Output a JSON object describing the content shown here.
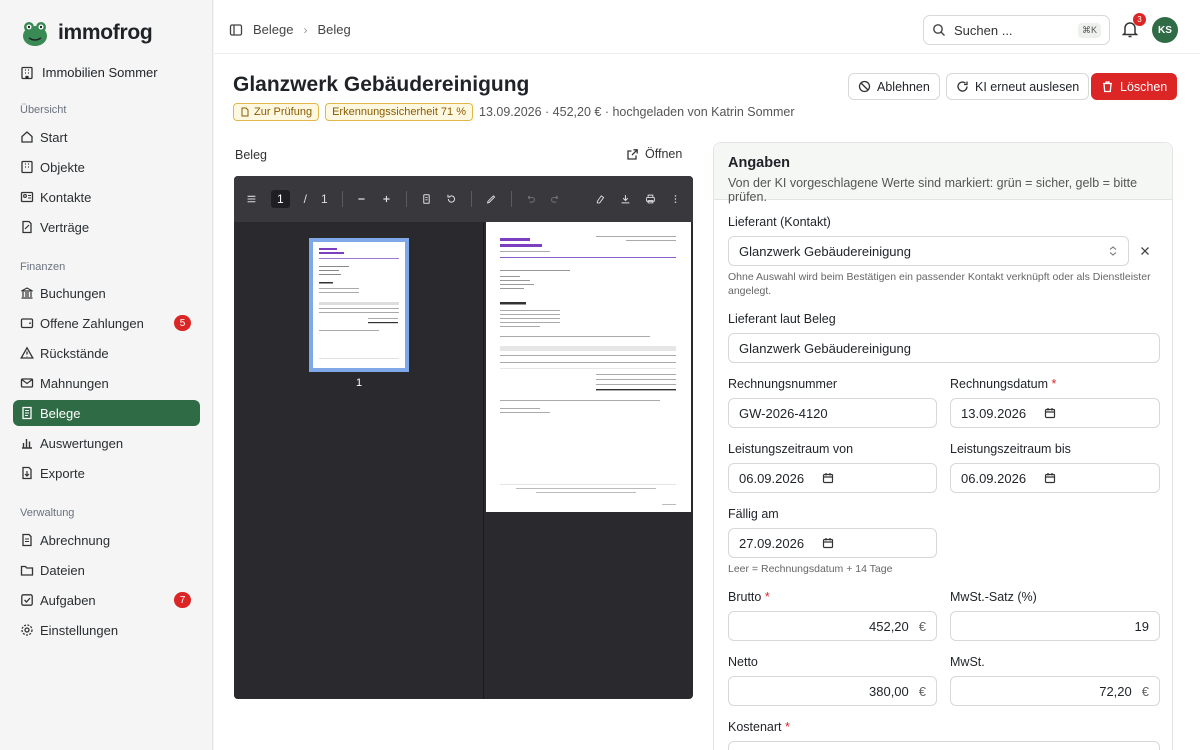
{
  "app": {
    "name": "immofrog",
    "org": "Immobilien Sommer"
  },
  "sidebar": {
    "sections": [
      {
        "label": "Übersicht",
        "items": [
          {
            "label": "Start"
          },
          {
            "label": "Objekte"
          },
          {
            "label": "Kontakte"
          },
          {
            "label": "Verträge"
          }
        ]
      },
      {
        "label": "Finanzen",
        "items": [
          {
            "label": "Buchungen"
          },
          {
            "label": "Offene Zahlungen",
            "badge": "5"
          },
          {
            "label": "Rückstände"
          },
          {
            "label": "Mahnungen"
          },
          {
            "label": "Belege",
            "active": true
          },
          {
            "label": "Auswertungen"
          },
          {
            "label": "Exporte"
          }
        ]
      },
      {
        "label": "Verwaltung",
        "items": [
          {
            "label": "Abrechnung"
          },
          {
            "label": "Dateien"
          },
          {
            "label": "Aufgaben",
            "badge": "7"
          },
          {
            "label": "Einstellungen"
          }
        ]
      }
    ]
  },
  "topbar": {
    "breadcrumb": [
      "Belege",
      "Beleg"
    ],
    "search_placeholder": "Suchen ...",
    "search_shortcut": "⌘K",
    "notifications": "3",
    "avatar_initials": "KS"
  },
  "header": {
    "title": "Glanzwerk Gebäudereinigung",
    "status_badge": "Zur Prüfung",
    "confidence_badge": "Erkennungssicherheit 71 %",
    "meta": "13.09.2026 · 452,20 € · hochgeladen von Katrin Sommer",
    "actions": {
      "reject": "Ablehnen",
      "reread": "KI erneut auslesen",
      "delete": "Löschen"
    }
  },
  "document": {
    "label": "Beleg",
    "open_label": "Öffnen",
    "page_current": "1",
    "page_total": "1",
    "thumb_number": "1"
  },
  "form": {
    "title": "Angaben",
    "subtitle": "Von der KI vorgeschlagene Werte sind markiert: grün = sicher, gelb = bitte prüfen.",
    "supplier_label": "Lieferant (Kontakt)",
    "supplier_value": "Glanzwerk Gebäudereinigung",
    "supplier_hint": "Ohne Auswahl wird beim Bestätigen ein passender Kontakt verknüpft oder als Dienstleister angelegt.",
    "supplier_doc_label": "Lieferant laut Beleg",
    "supplier_doc_value": "Glanzwerk Gebäudereinigung",
    "invoice_no_label": "Rechnungsnummer",
    "invoice_no_value": "GW-2026-4120",
    "invoice_date_label": "Rechnungsdatum",
    "invoice_date_value": "13.09.2026",
    "period_from_label": "Leistungszeitraum von",
    "period_from_value": "06.09.2026",
    "period_to_label": "Leistungszeitraum bis",
    "period_to_value": "06.09.2026",
    "due_label": "Fällig am",
    "due_value": "27.09.2026",
    "due_hint": "Leer = Rechnungsdatum + 14 Tage",
    "gross_label": "Brutto",
    "gross_value": "452,20",
    "vat_rate_label": "MwSt.-Satz (%)",
    "vat_rate_value": "19",
    "net_label": "Netto",
    "net_value": "380,00",
    "vat_label": "MwSt.",
    "vat_value": "72,20",
    "currency": "€",
    "cost_type_label": "Kostenart"
  },
  "colors": {
    "brand": "#2f6b45",
    "danger": "#dc2626",
    "warning": "#e2b84a"
  }
}
